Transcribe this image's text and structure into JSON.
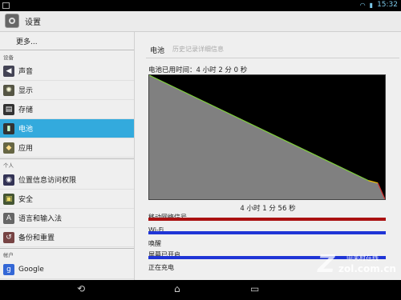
{
  "status_bar": {
    "time": "15:32"
  },
  "action_bar": {
    "title": "设置"
  },
  "sidebar": {
    "more_label": "更多...",
    "sections": {
      "device": "设备",
      "personal": "个人",
      "accounts": "帐户"
    },
    "items": [
      {
        "label": "声音",
        "icon": "speaker-icon"
      },
      {
        "label": "显示",
        "icon": "brightness-icon"
      },
      {
        "label": "存储",
        "icon": "storage-icon"
      },
      {
        "label": "电池",
        "icon": "battery-icon",
        "active": true
      },
      {
        "label": "应用",
        "icon": "apps-icon"
      },
      {
        "label": "位置信息访问权限",
        "icon": "location-icon"
      },
      {
        "label": "安全",
        "icon": "lock-icon"
      },
      {
        "label": "语言和输入法",
        "icon": "language-icon"
      },
      {
        "label": "备份和重置",
        "icon": "backup-icon"
      },
      {
        "label": "Google",
        "icon": "google-icon"
      }
    ]
  },
  "main": {
    "tabs": {
      "battery": "电池",
      "history": "历史记录详细信息"
    },
    "battery_time": "电池已用时间：4 小时 2 分 0 秒",
    "duration": "4 小时 1 分 56 秒",
    "signals": [
      {
        "label": "移动网络信号",
        "color": "#aa1111"
      },
      {
        "label": "Wi-Fi",
        "color": "#1f35d6"
      },
      {
        "label": "唤醒",
        "color": ""
      },
      {
        "label": "屏幕已开启",
        "color": "#1f35d6"
      },
      {
        "label": "正在充电",
        "color": ""
      }
    ]
  },
  "chart_data": {
    "type": "area",
    "title": "",
    "xlabel": "",
    "ylabel": "",
    "x": [
      0,
      0.93,
      0.97,
      1.0
    ],
    "values": [
      100,
      15,
      13,
      0
    ],
    "ylim": [
      0,
      100
    ],
    "fill_color": "#808080",
    "line_colors": {
      "high": "#7fd13b",
      "mid": "#f2c100",
      "low": "#d32f2f"
    }
  },
  "watermark": {
    "big": "Z",
    "line1": "中关村在线",
    "line2": "zol.com.cn"
  }
}
